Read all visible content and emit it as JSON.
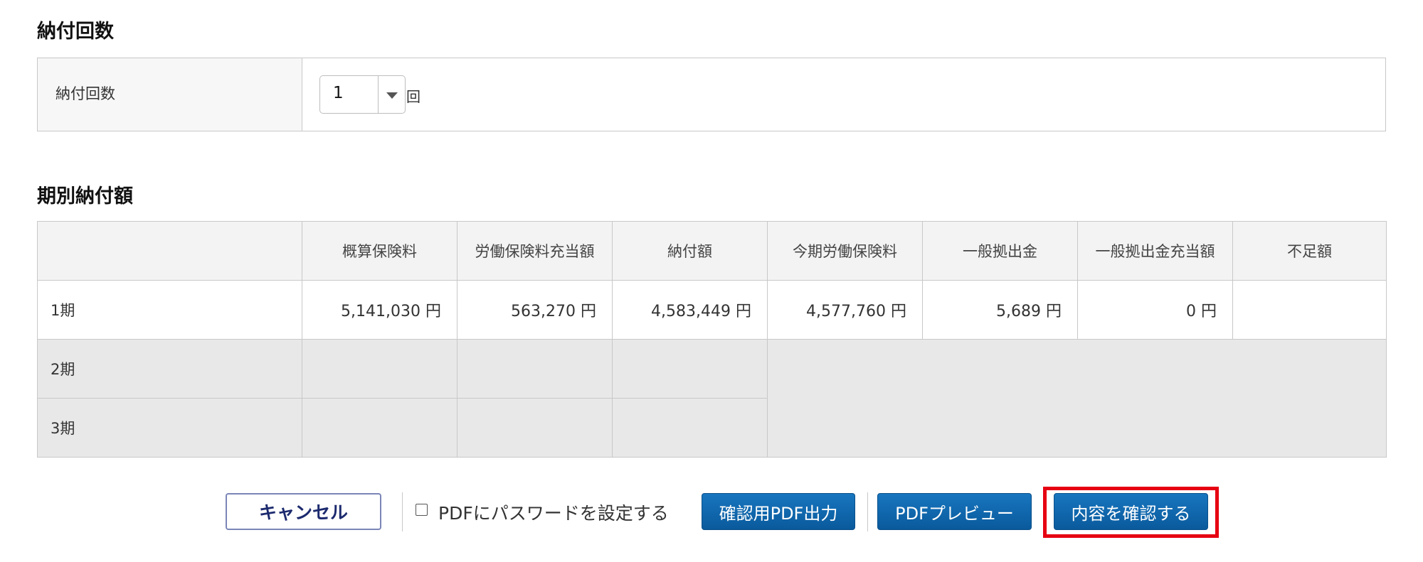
{
  "sections": {
    "count_title": "納付回数",
    "period_title": "期別納付額"
  },
  "count": {
    "label": "納付回数",
    "value": "1",
    "unit": "回"
  },
  "period_table": {
    "headers": [
      "",
      "概算保険料",
      "労働保険料充当額",
      "納付額",
      "今期労働保険料",
      "一般拠出金",
      "一般拠出金充当額",
      "不足額"
    ],
    "rows": [
      {
        "label": "1期",
        "cells": [
          "5,141,030 円",
          "563,270 円",
          "4,583,449 円",
          "4,577,760 円",
          "5,689 円",
          "0 円",
          ""
        ]
      },
      {
        "label": "2期",
        "cells": [
          "",
          "",
          ""
        ]
      },
      {
        "label": "3期",
        "cells": [
          "",
          "",
          ""
        ]
      }
    ]
  },
  "actions": {
    "cancel": "キャンセル",
    "pdf_password": "PDFにパスワードを設定する",
    "pdf_output": "確認用PDF出力",
    "pdf_preview": "PDFプレビュー",
    "confirm": "内容を確認する"
  },
  "colors": {
    "primary_button": "#0a5a9c",
    "highlight_frame": "#e60012"
  }
}
